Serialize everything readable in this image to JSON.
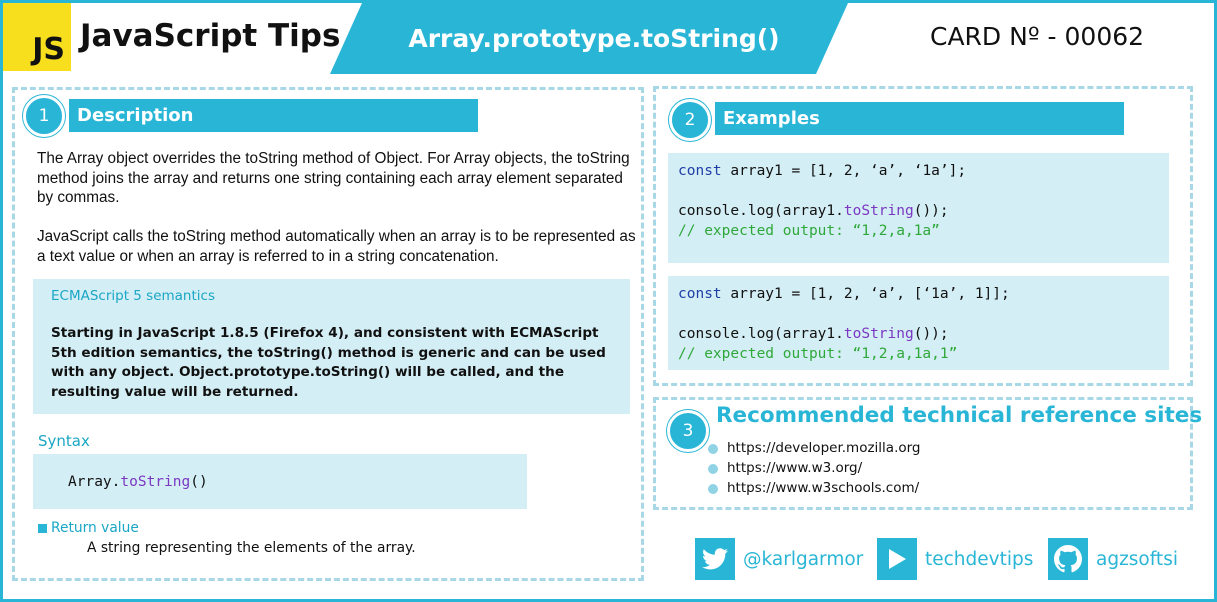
{
  "header": {
    "logo_text": "JS",
    "brand_title": "JavaScript Tips",
    "title": "Array.prototype.toString()",
    "card_number": "CARD Nº - 00062"
  },
  "description": {
    "number": "1",
    "heading": "Description",
    "paragraph1": "The Array object overrides the toString method of Object. For Array objects, the toString method joins the array and returns one string containing each array element separated by commas.",
    "paragraph2": "JavaScript calls the toString method automatically when an array is to be represented as a text value or when an array is referred to in a string concatenation.",
    "semantics": {
      "title": "ECMAScript 5 semantics",
      "body": "Starting in JavaScript 1.8.5 (Firefox 4), and consistent with ECMAScript 5th edition semantics, the toString() method is generic and can be used with any object. Object.prototype.toString() will be called, and the resulting value will be returned."
    },
    "syntax": {
      "label": "Syntax",
      "object": "Array.",
      "method": "toString",
      "parens": "()"
    },
    "return_value": {
      "label": "Return value",
      "text": "A string representing the elements of the array."
    }
  },
  "examples": {
    "number": "2",
    "heading": "Examples",
    "example1": {
      "decl_kw": "const",
      "decl_rest": " array1 = [1, 2, ‘a’, ‘1a’];",
      "log_prefix": "console.log(array1.",
      "log_method": "toString",
      "log_suffix": "());",
      "comment": "// expected output: “1,2,a,1a”"
    },
    "example2": {
      "decl_kw": "const",
      "decl_rest": " array1 = [1, 2, ‘a’, [‘1a’, 1]];",
      "log_prefix": "console.log(array1.",
      "log_method": "toString",
      "log_suffix": "());",
      "comment": "// expected output: “1,2,a,1a,1”"
    }
  },
  "references": {
    "number": "3",
    "heading": "Recommended technical reference sites",
    "sites": [
      "https://developer.mozilla.org",
      "https://www.w3.org/",
      "https://www.w3schools.com/"
    ]
  },
  "social": [
    {
      "icon": "twitter-icon",
      "handle": "@karlgarmor"
    },
    {
      "icon": "youtube-play-icon",
      "handle": "techdevtips"
    },
    {
      "icon": "github-icon",
      "handle": "agzsoftsi"
    }
  ],
  "colors": {
    "accent": "#29b6d6",
    "code_bg": "#d4eef5",
    "js_yellow": "#f7df1e",
    "keyword": "#1f3fa6",
    "method": "#7b38c2",
    "comment": "#2fa83a"
  }
}
